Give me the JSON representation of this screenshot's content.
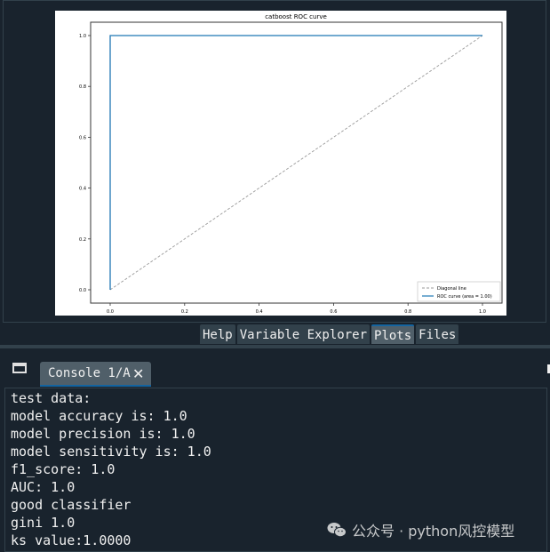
{
  "plot": {
    "chart_data": {
      "type": "line",
      "title": "catboost ROC curve",
      "xlim": [
        0.0,
        1.0
      ],
      "ylim": [
        0.0,
        1.0
      ],
      "x_ticks": [
        "0.0",
        "0.2",
        "0.4",
        "0.6",
        "0.8",
        "1.0"
      ],
      "y_ticks": [
        "0.0",
        "0.2",
        "0.4",
        "0.6",
        "0.8",
        "1.0"
      ],
      "series": [
        {
          "name": "Diagonal line",
          "style": "dashed",
          "color": "#999999",
          "x": [
            0.0,
            1.0
          ],
          "y": [
            0.0,
            1.0
          ]
        },
        {
          "name": "ROC curve (area = 1.00)",
          "style": "solid",
          "color": "#1f77b4",
          "x": [
            0.0,
            0.0,
            1.0
          ],
          "y": [
            0.0,
            1.0,
            1.0
          ]
        }
      ],
      "legend_position": "lower-right",
      "grid": false
    }
  },
  "tabs": [
    {
      "label": "Help",
      "active": false
    },
    {
      "label": "Variable Explorer",
      "active": false
    },
    {
      "label": "Plots",
      "active": true
    },
    {
      "label": "Files",
      "active": false
    }
  ],
  "console": {
    "tab_label": "Console 1/A",
    "close_glyph": "✕",
    "lines": [
      "test data:",
      "model accuracy is: 1.0",
      "model precision is: 1.0",
      "model sensitivity is: 1.0",
      "f1_score: 1.0",
      "AUC: 1.0",
      "good classifier",
      "gini 1.0",
      "ks value:1.0000"
    ]
  },
  "watermark": {
    "text": "公众号 · python风控模型"
  },
  "colors": {
    "background": "#19232d",
    "accent": "#1464a0"
  }
}
